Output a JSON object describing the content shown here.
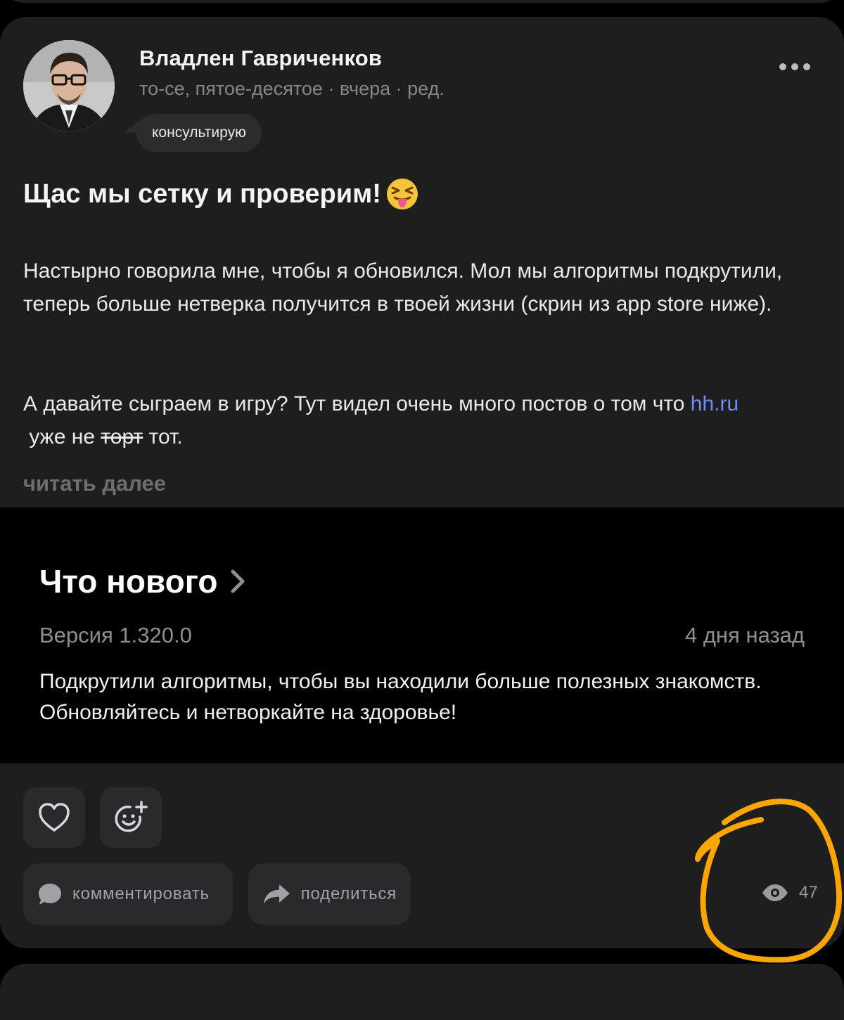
{
  "post": {
    "author_name": "Владлен Гавриченков",
    "meta": "то-се, пятое-десятое · вчера · ред.",
    "status_badge": "консультирую",
    "title": "Щас мы сетку и проверим!",
    "paragraph1": "Настырно говорила мне, чтобы я обновился. Мол мы алгоритмы подкрутили, теперь больше нетверка получится в твоей жизни (скрин из app store ниже).",
    "paragraph2_start": "А давайте сыграем в игру? Тут видел очень много постов о том что",
    "link_text": "hh.ru",
    "paragraph2_mid": " уже не ",
    "strike_text": "торт",
    "paragraph2_end": " тот.",
    "read_more": "читать далее"
  },
  "screenshot": {
    "title": "Что нового",
    "version": "Версия 1.320.0",
    "date": "4 дня назад",
    "body": "Подкрутили алгоритмы, чтобы вы находили больше полезных знакомств. Обновляйтесь и нетворкайте на здоровье!"
  },
  "actions": {
    "like_icon": "heart-icon",
    "react_icon": "add-emoji-icon",
    "comment_label": "комментировать",
    "share_label": "поделиться",
    "views_count": "47"
  },
  "colors": {
    "background": "#000000",
    "card": "#1e1e1f",
    "link": "#6e8cff",
    "highlight_circle": "#ffa500"
  }
}
